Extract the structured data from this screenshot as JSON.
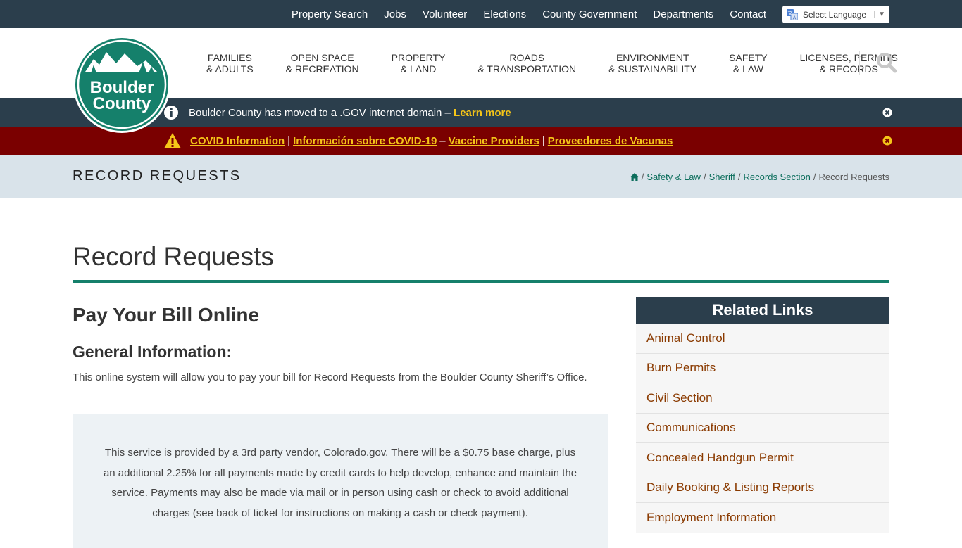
{
  "utility_nav": [
    "Property Search",
    "Jobs",
    "Volunteer",
    "Elections",
    "County Government",
    "Departments",
    "Contact"
  ],
  "language": {
    "label": "Select Language",
    "caret": "▼"
  },
  "logo": {
    "line1": "Boulder",
    "line2": "County"
  },
  "main_nav": [
    {
      "line1": "Families",
      "line2": "& Adults"
    },
    {
      "line1": "Open Space",
      "line2": "& Recreation"
    },
    {
      "line1": "Property",
      "line2": "& Land"
    },
    {
      "line1": "Roads",
      "line2": "& Transportation"
    },
    {
      "line1": "Environment",
      "line2": "& Sustainability"
    },
    {
      "line1": "Safety",
      "line2": "& Law"
    },
    {
      "line1": "Licenses, Permits",
      "line2": "& Records"
    }
  ],
  "gov_alert": {
    "text": "Boulder County has moved to a .GOV internet domain –",
    "link": "Learn more"
  },
  "covid_alert": {
    "link1": "COVID Information",
    "sep1": "|",
    "link2": "Información sobre COVID-19",
    "sep2": "–",
    "link3": "Vaccine Providers",
    "sep3": "|",
    "link4": "Proveedores de Vacunas"
  },
  "strip_title": "Record Requests",
  "breadcrumb": {
    "items": [
      "Safety & Law",
      "Sheriff",
      "Records Section"
    ],
    "current": "Record Requests",
    "sep": "/"
  },
  "page_title": "Record Requests",
  "section_heading": "Pay Your Bill Online",
  "sub_heading": "General Information:",
  "intro_text": "This online system will allow you to pay your bill for Record Requests from the Boulder County Sheriff’s Office.",
  "notice_text": "This service is provided by a 3rd party vendor, Colorado.gov. There will be a $0.75 base charge, plus an additional 2.25% for all payments made by credit cards to help develop, enhance and maintain the service. Payments may also be made via mail or in person using cash or check to avoid additional charges (see back of ticket for instructions on making a cash or check payment).",
  "related": {
    "title": "Related Links",
    "links": [
      "Animal Control",
      "Burn Permits",
      "Civil Section",
      "Communications",
      "Concealed Handgun Permit",
      "Daily Booking & Listing Reports",
      "Employment Information"
    ]
  },
  "colors": {
    "dark_bar": "#2b3e4c",
    "covid_bar": "#7a0000",
    "accent_green": "#15806b",
    "link_yellow": "#f5c518",
    "related_link": "#8a3a00"
  }
}
